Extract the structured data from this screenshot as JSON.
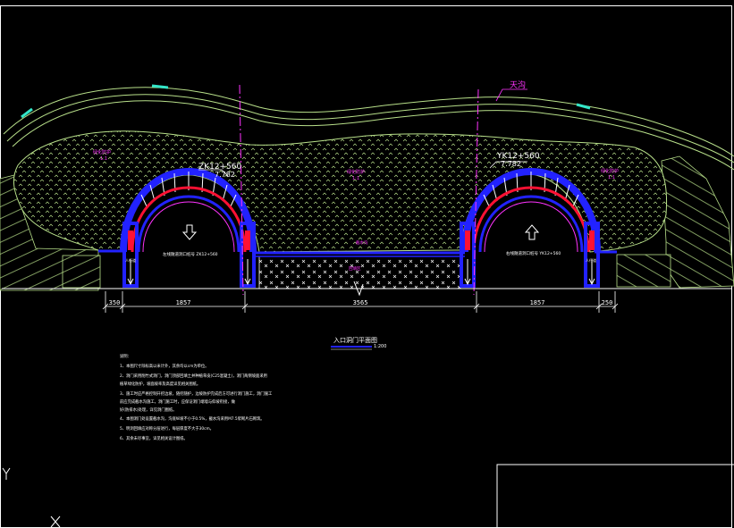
{
  "colors": {
    "bg": "#000000",
    "white": "#ffffff",
    "green": "#b8e08a",
    "blue": "#2222ff",
    "red": "#ff1133",
    "magenta": "#ff33ff",
    "cyan": "#33e6c8",
    "yellow": "#ffff00"
  },
  "drawing": {
    "top_label": "天沟",
    "left_station": "ZK12+560",
    "left_elev": "7.782",
    "right_station": "YK12+560",
    "right_elev": "7.782",
    "left_slope_label": "绿化防护",
    "left_slope_sub": "1:1",
    "center_slope_label": "绿化防护",
    "center_slope_sub": "1:1",
    "right_slope_label": "绿化防护",
    "right_slope_sub": "1:1",
    "left_road_label": "左线隧道洞口桩号 ZK12+560",
    "right_road_label": "右线隧道洞口桩号 YK12+560",
    "left_foot_label": "人行道",
    "right_foot_label": "人行道",
    "mid_label": "截水沟",
    "mid_fill_label": "回填区"
  },
  "dimensions": [
    "350",
    "1857",
    "3565",
    "1857",
    "250"
  ],
  "title": {
    "main": "入口洞门平面图",
    "scale": "1:200"
  },
  "notes": {
    "heading": "说明：",
    "items": [
      "1、本图尺寸除标高以米计外，其余均以cm为单位。",
      "2、洞门采用削竹式洞门，洞门顶部回填土并种植草皮(C25混凝土)，洞门两侧坡面采用",
      "   植草绿化防护，坡面坡率及高度详见相关图纸。",
      "3、施工时应严格控制开挖边坡，随挖随护，边坡防护完成后方可进行洞门施工，洞门施工",
      "   前应完成截水沟施工，洞门施工时，应保证洞门端墙与仰坡衔接，做",
      "   好(防排水)处理，详见洞门图纸。",
      "4、本图洞门处设置截水沟，沟底纵坡不小于0.5%，截水沟采用M7.5浆砌片石砌筑。",
      "5、明洞回填应对称分层进行，每层厚度不大于30cm。",
      "6、其余未尽事宜，详见相关设计图纸。"
    ]
  }
}
